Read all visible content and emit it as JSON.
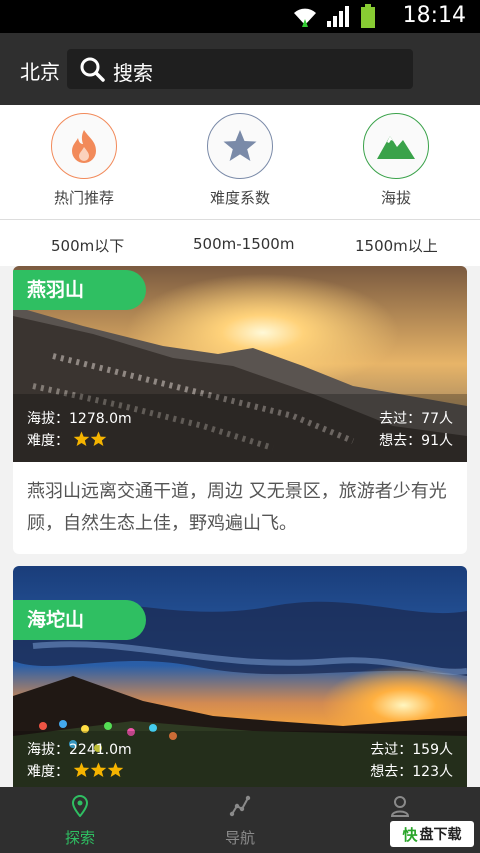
{
  "status_bar": {
    "time": "18:14",
    "icons": [
      "wifi-icon",
      "signal-icon",
      "battery-icon"
    ]
  },
  "header": {
    "city": "北京",
    "search_placeholder": "搜索"
  },
  "filters": [
    {
      "label": "热门推荐",
      "icon": "fire-icon",
      "color": "#f28a5a"
    },
    {
      "label": "难度系数",
      "icon": "star-icon",
      "color": "#7a8aa8"
    },
    {
      "label": "海拔",
      "icon": "mountain-icon",
      "color": "#3aa24a"
    }
  ],
  "altitude_options": [
    "500m以下",
    "500m-1500m",
    "1500m以上"
  ],
  "cards": [
    {
      "name": "燕羽山",
      "altitude": "海拔：1278.0m",
      "difficulty_label": "难度：",
      "difficulty_stars": 2,
      "visited": "去过：77人",
      "want": "想去：91人",
      "description": "燕羽山远离交通干道，周边 又无景区，旅游者少有光顾，自然生态上佳，野鸡遍山飞。"
    },
    {
      "name": "海坨山",
      "altitude": "海拔：2241.0m",
      "difficulty_label": "难度：",
      "difficulty_stars": 3,
      "visited": "去过：159人",
      "want": "想去：123人"
    }
  ],
  "bottom_nav": [
    {
      "label": "探索",
      "icon": "location-pin-icon",
      "active": true
    },
    {
      "label": "导航",
      "icon": "route-icon",
      "active": false
    },
    {
      "label": "我",
      "icon": "person-icon",
      "active": false
    }
  ],
  "watermark": {
    "part1": "快",
    "part2": "盘下载"
  },
  "colors": {
    "accent": "#2fbf62",
    "header": "#2f2f2f",
    "star": "#f5b400"
  }
}
